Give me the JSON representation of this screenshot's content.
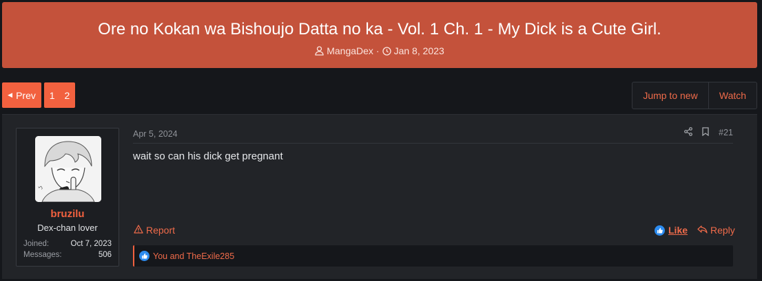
{
  "thread": {
    "title": "Ore no Kokan wa Bishoujo Datta no ka - Vol. 1 Ch. 1 - My Dick is a Cute Girl.",
    "author": "MangaDex",
    "separator": "·",
    "date": "Jan 8, 2023"
  },
  "pagination": {
    "prev_label": "Prev",
    "pages": [
      "1",
      "2"
    ]
  },
  "thread_actions": {
    "jump_label": "Jump to new",
    "watch_label": "Watch"
  },
  "post": {
    "date": "Apr 5, 2024",
    "number": "#21",
    "body": "wait so can his dick get pregnant",
    "report_label": "Report",
    "like_label": "Like",
    "reply_label": "Reply",
    "reactions_text": "You and TheExile285",
    "user": {
      "name": "bruzilu",
      "title": "Dex-chan lover",
      "joined_label": "Joined:",
      "joined_value": "Oct 7, 2023",
      "messages_label": "Messages:",
      "messages_value": "506"
    }
  },
  "colors": {
    "banner": "#c4523b",
    "accent": "#f2613f",
    "link": "#f06b4a",
    "background": "#15171b",
    "post_bg": "#222428",
    "like_blue": "#2d8cf0"
  }
}
